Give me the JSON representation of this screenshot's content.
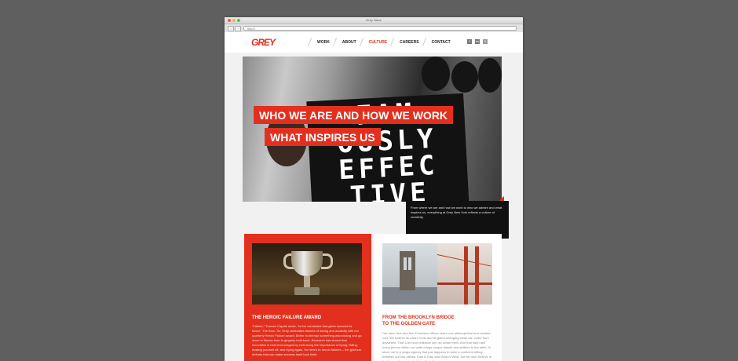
{
  "browser": {
    "window_title": "Grey Value",
    "address": "http://"
  },
  "nav": {
    "logo": "GREY",
    "items": [
      {
        "label": "WORK",
        "active": false
      },
      {
        "label": "ABOUT",
        "active": false
      },
      {
        "label": "CULTURE",
        "active": true
      },
      {
        "label": "CAREERS",
        "active": false
      },
      {
        "label": "CONTACT",
        "active": false
      }
    ],
    "social_icons": [
      "facebook-icon",
      "linkedin-icon",
      "twitter-icon"
    ]
  },
  "hero": {
    "heading_1": "WHO WE ARE AND HOW WE WORK",
    "heading_2": "WHAT INSPIRES US",
    "banner_lines": [
      "FAM",
      "OUSLY",
      "EFFEC",
      "TIVE"
    ],
    "caption": "From where we are and how we work to who we admire and what inspires us, everything at Grey New York reflects a culture of creativity."
  },
  "cards": [
    {
      "title": "THE HEROIC FAILURE AWARD",
      "body": "\"Failure,\" Truman Capote wrote, \"is the condiment that gives success its flavor.\" The thus, Tic: Grey celebrates failures of daring and audacity with our quarterly Heroic Failure award. Better to attempt something astonishing and go down in flames than to gingerly hold back. Research has shown that innovation is best encouraged by embracing the importance of trying, failing, dusting yourself off, and trying again. So here's to heroic failures – the glorious defeats that can make success itself look timid."
    },
    {
      "title_line_1": "FROM THE BROOKLYN BRIDGE",
      "title_line_2": "TO THE GOLDEN GATE",
      "body": "Our New York and San Francisco offices share one philosophical and creative root. We believe an idea's roots and its game-changing ideas can come from anywhere. That 11th hour brilliance isn't an urban myth. And that each and every person within our walls brings unique talents and abilities to the table. In short, we're a single agency that just happens to have a continent sitting between our two offices. East is East and West is West, but we don't believe in that \"never the twain shall meet\" stuff."
    }
  ],
  "colors": {
    "accent": "#e3301e",
    "background": "#5f5f5f",
    "page": "#f1f1f1"
  }
}
